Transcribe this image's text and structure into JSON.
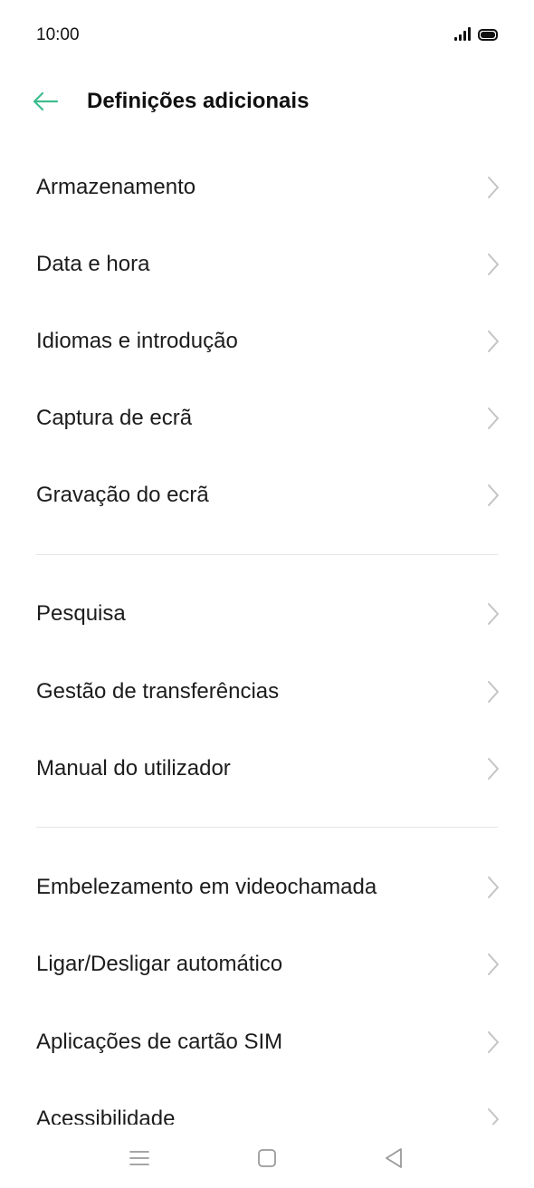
{
  "status_bar": {
    "time": "10:00",
    "icons": [
      "signal-icon",
      "battery-icon"
    ]
  },
  "header": {
    "title": "Definições adicionais",
    "back_icon": "arrow-left-icon",
    "accent_color": "#3dbd8f"
  },
  "groups": [
    {
      "items": [
        {
          "label": "Armazenamento"
        },
        {
          "label": "Data e hora"
        },
        {
          "label": "Idiomas e introdução"
        },
        {
          "label": "Captura de ecrã"
        },
        {
          "label": "Gravação do ecrã"
        }
      ]
    },
    {
      "items": [
        {
          "label": "Pesquisa"
        },
        {
          "label": "Gestão de transferências"
        },
        {
          "label": "Manual do utilizador"
        }
      ]
    },
    {
      "items": [
        {
          "label": "Embelezamento em videochamada"
        },
        {
          "label": "Ligar/Desligar automático"
        },
        {
          "label": "Aplicações de cartão SIM"
        },
        {
          "label": "Acessibilidade"
        }
      ]
    }
  ],
  "nav_bar": {
    "buttons": [
      "menu-icon",
      "home-icon",
      "back-triangle-icon"
    ]
  },
  "colors": {
    "chevron": "#c4c4c4",
    "divider": "#e6e6e6",
    "nav_icon": "#9a9a9a"
  }
}
